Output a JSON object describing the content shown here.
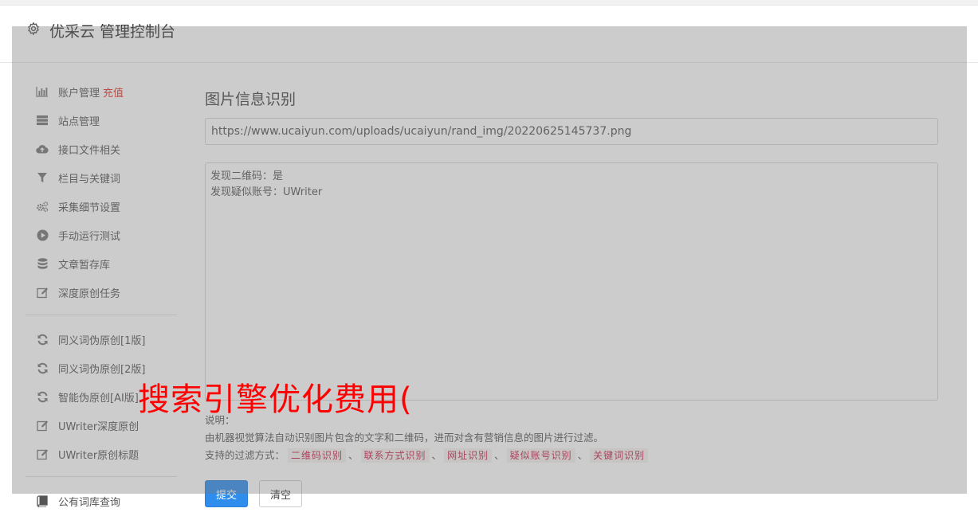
{
  "header": {
    "title": "优采云 管理控制台",
    "icon": "gear-icon"
  },
  "sidebar": {
    "group1": [
      {
        "label": "账户管理",
        "badge": "充值",
        "icon": "bar-chart-icon"
      },
      {
        "label": "站点管理",
        "icon": "server-icon"
      },
      {
        "label": "接口文件相关",
        "icon": "cloud-upload-icon"
      },
      {
        "label": "栏目与关键词",
        "icon": "filter-icon"
      },
      {
        "label": "采集细节设置",
        "icon": "cogs-icon"
      },
      {
        "label": "手动运行测试",
        "icon": "play-circle-icon"
      },
      {
        "label": "文章暂存库",
        "icon": "database-icon"
      },
      {
        "label": "深度原创任务",
        "icon": "edit-icon"
      }
    ],
    "group2": [
      {
        "label": "同义词伪原创[1版]",
        "icon": "refresh-icon"
      },
      {
        "label": "同义词伪原创[2版]",
        "icon": "refresh-icon"
      },
      {
        "label": "智能伪原创[AI版]",
        "icon": "refresh-icon"
      },
      {
        "label": "UWriter深度原创",
        "icon": "edit-icon"
      },
      {
        "label": "UWriter原创标题",
        "icon": "edit-icon"
      }
    ],
    "group3": [
      {
        "label": "公有词库查询",
        "icon": "book-icon"
      }
    ]
  },
  "main": {
    "title": "图片信息识别",
    "url_value": "https://www.ucaiyun.com/uploads/ucaiyun/rand_img/20220625145737.png",
    "result_lines": [
      "发现二维码：是",
      "发现疑似账号：UWriter"
    ],
    "notes_label": "说明：",
    "notes_desc": "由机器视觉算法自动识别图片包含的文字和二维码，进而对含有营销信息的图片进行过滤。",
    "filter_label": "支持的过滤方式：",
    "filter_tags": [
      "二维码识别",
      "联系方式识别",
      "网址识别",
      "疑似账号识别",
      "关键词识别"
    ],
    "separator": "、",
    "submit_label": "提交",
    "clear_label": "清空"
  },
  "watermark": "搜索引擎优化费用(",
  "colors": {
    "accent": "#2e8ded",
    "badge": "#e0352b",
    "tag_text": "#c7254e",
    "watermark": "#ff0000",
    "overlay": "rgba(120,120,120,0.38)"
  }
}
